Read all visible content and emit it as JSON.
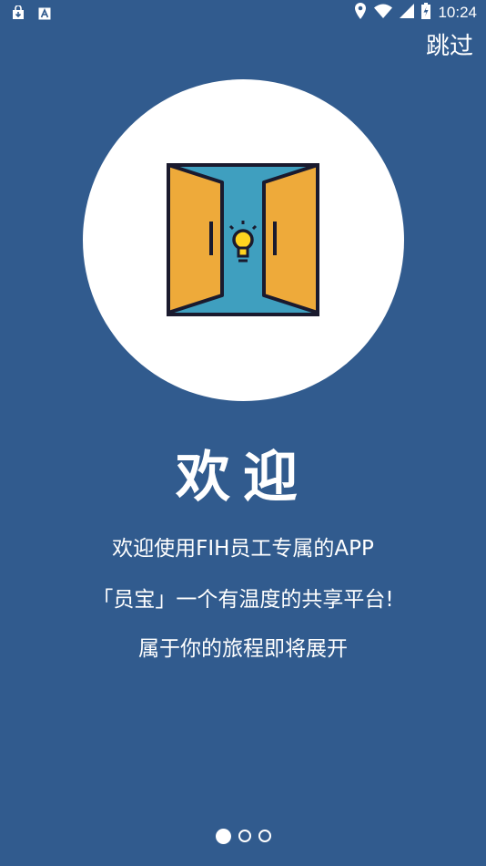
{
  "status_bar": {
    "time": "10:24",
    "left_icons": [
      "download-bag-icon",
      "keyboard-a-icon"
    ],
    "right_icons": [
      "location-icon",
      "wifi-icon",
      "cell-signal-icon",
      "battery-charging-icon"
    ]
  },
  "skip_label": "跳过",
  "hero": {
    "icon": "door-lightbulb-icon"
  },
  "title": "欢迎",
  "description": {
    "line1": "欢迎使用FIH员工专属的APP",
    "line2": "「员宝」一个有温度的共享平台!",
    "line3": "属于你的旅程即将展开"
  },
  "pager": {
    "current": 1,
    "total": 3
  },
  "colors": {
    "background": "#315b8e",
    "door_yellow": "#eeaa3a",
    "door_teal": "#3f9fbf",
    "bulb_yellow": "#ffd31f",
    "outline": "#1a1a2e"
  }
}
